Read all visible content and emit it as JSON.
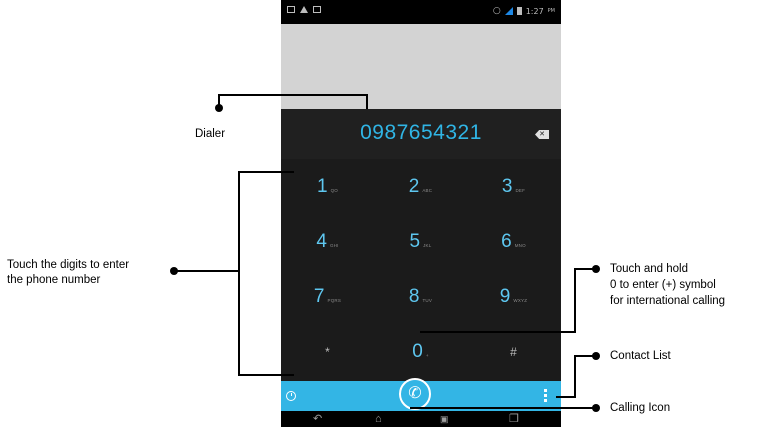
{
  "status_bar": {
    "time": "1:27",
    "ampm": "PM"
  },
  "dialer": {
    "number": "0987654321",
    "backspace_icon": "backspace-icon",
    "keys": [
      {
        "digit": "1",
        "letters": "QO"
      },
      {
        "digit": "2",
        "letters": "ABC"
      },
      {
        "digit": "3",
        "letters": "DEF"
      },
      {
        "digit": "4",
        "letters": "GHI"
      },
      {
        "digit": "5",
        "letters": "JKL"
      },
      {
        "digit": "6",
        "letters": "MNO"
      },
      {
        "digit": "7",
        "letters": "PQRS"
      },
      {
        "digit": "8",
        "letters": "TUV"
      },
      {
        "digit": "9",
        "letters": "WXYZ"
      },
      {
        "digit": "*",
        "letters": ""
      },
      {
        "digit": "0",
        "letters": "+"
      },
      {
        "digit": "#",
        "letters": ""
      }
    ]
  },
  "call_bar": {
    "left_icon": "clock-icon",
    "center_icon": "phone-icon",
    "right_icon": "menu-icon"
  },
  "nav_bar": {
    "icons": [
      "back-icon",
      "home-icon",
      "screenshot-icon",
      "recent-apps-icon"
    ]
  },
  "annotations": {
    "dialer": "Dialer",
    "digits_line1": "Touch the digits to enter",
    "digits_line2": "the phone number",
    "hold_line1": "Touch and hold",
    "hold_line2": "0 to enter (+) symbol",
    "hold_line3": "for international calling",
    "contact_list": "Contact List",
    "calling_icon": "Calling Icon"
  },
  "colors": {
    "accent": "#33b5e5",
    "number_text": "#30b5e5",
    "key_text": "#5ec7f0",
    "dial_bg": "#1b1b1b"
  }
}
